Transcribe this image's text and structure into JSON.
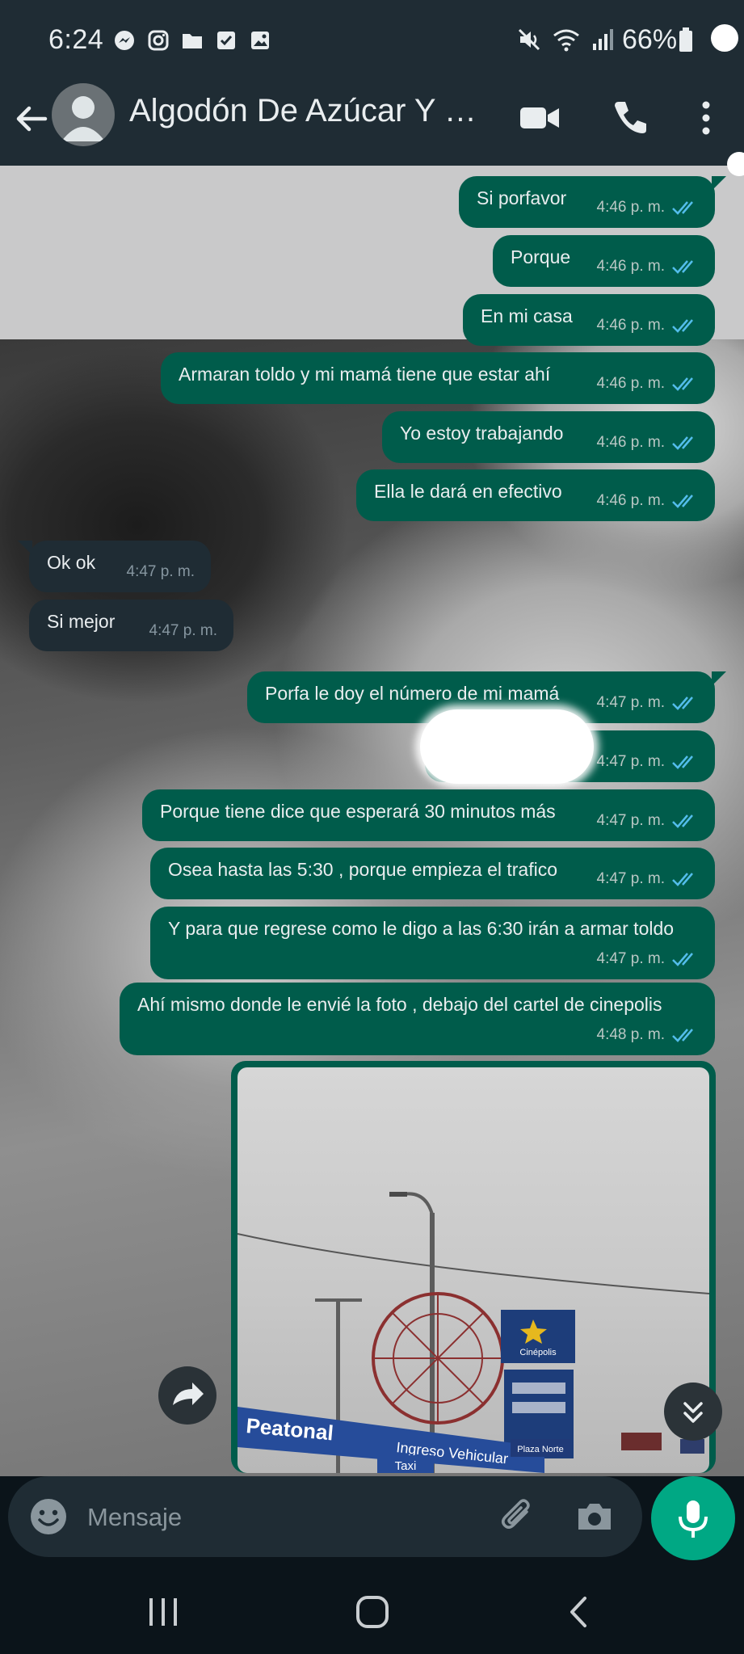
{
  "status_bar": {
    "time": "6:24",
    "battery": "66%",
    "icons_left": [
      "messenger-icon",
      "instagram-icon",
      "folder-icon",
      "checkbox-icon",
      "gallery-icon"
    ],
    "icons_right": [
      "mute-icon",
      "wifi-icon",
      "signal-icon",
      "battery-icon"
    ]
  },
  "header": {
    "contact_name": "Algodón De Azúcar Y M...",
    "actions": [
      "video-call-icon",
      "phone-icon",
      "more-icon"
    ]
  },
  "messages": [
    {
      "dir": "out",
      "text": "Si porfavor",
      "time": "4:46 p. m."
    },
    {
      "dir": "out",
      "text": "Porque",
      "time": "4:46 p. m."
    },
    {
      "dir": "out",
      "text": "En mi casa",
      "time": "4:46 p. m."
    },
    {
      "dir": "out",
      "text": "Armaran toldo y mi mamá tiene que estar ahí",
      "time": "4:46 p. m."
    },
    {
      "dir": "out",
      "text": "Yo estoy trabajando",
      "time": "4:46 p. m."
    },
    {
      "dir": "out",
      "text": "Ella le dará en efectivo",
      "time": "4:46 p. m."
    },
    {
      "dir": "in",
      "text": "Ok ok",
      "time": "4:47 p. m."
    },
    {
      "dir": "in",
      "text": "Si mejor",
      "time": "4:47 p. m."
    },
    {
      "dir": "out",
      "text": "Porfa le doy el número de mi mamá",
      "time": "4:47 p. m."
    },
    {
      "dir": "out",
      "text": "",
      "time": "4:47 p. m."
    },
    {
      "dir": "out",
      "text": "Porque tiene dice que esperará 30 minutos más",
      "time": "4:47 p. m."
    },
    {
      "dir": "out",
      "text": "Osea hasta las 5:30 , porque empieza el trafico",
      "time": "4:47 p. m."
    },
    {
      "dir": "out",
      "text": "Y para que regrese como le digo a las 6:30 irán a armar toldo",
      "time": "4:47 p. m."
    },
    {
      "dir": "out",
      "text": "Ahí mismo donde le envié la foto , debajo del cartel de cinepolis",
      "time": "4:48 p. m."
    }
  ],
  "photo_message": {
    "signs": {
      "peatonal": "Peatonal",
      "ingreso": "Ingreso Vehicular",
      "taxi": "Taxi",
      "cinepolis": "Cinépolis",
      "plaza": "Plaza Norte"
    }
  },
  "composer": {
    "placeholder": "Mensaje"
  },
  "colors": {
    "outgoing_bubble": "#005c4b",
    "incoming_bubble": "#1f2c34",
    "accent": "#00a884",
    "read_ticks": "#53bdeb"
  }
}
